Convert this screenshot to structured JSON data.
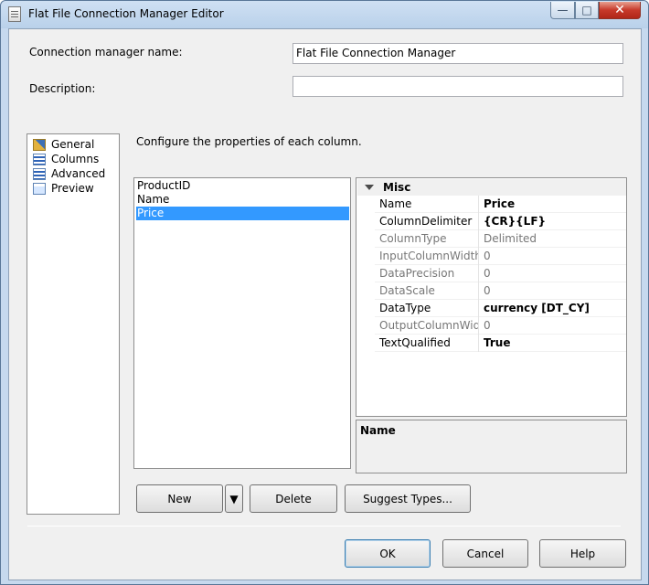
{
  "window": {
    "title": "Flat File Connection Manager Editor"
  },
  "controls": {
    "minimize": "—",
    "maximize": "□",
    "close": "✕"
  },
  "fields": {
    "connection_label": "Connection manager name:",
    "connection_value": "Flat File Connection Manager",
    "description_label": "Description:",
    "description_value": ""
  },
  "sidebar": {
    "items": [
      {
        "label": "General",
        "icon": "general-icon"
      },
      {
        "label": "Columns",
        "icon": "columns-icon"
      },
      {
        "label": "Advanced",
        "icon": "advanced-icon"
      },
      {
        "label": "Preview",
        "icon": "preview-icon"
      }
    ]
  },
  "main": {
    "instruction": "Configure the properties of each column.",
    "columns": [
      "ProductID",
      "Name",
      "Price"
    ],
    "selected_column": "Price"
  },
  "properties": {
    "category": "Misc",
    "rows": [
      {
        "name": "Name",
        "value": "Price",
        "enabled": true,
        "bold": true
      },
      {
        "name": "ColumnDelimiter",
        "value": "{CR}{LF}",
        "enabled": true,
        "bold": true
      },
      {
        "name": "ColumnType",
        "value": "Delimited",
        "enabled": false,
        "bold": false
      },
      {
        "name": "InputColumnWidth",
        "value": "0",
        "enabled": false,
        "bold": false
      },
      {
        "name": "DataPrecision",
        "value": "0",
        "enabled": false,
        "bold": false
      },
      {
        "name": "DataScale",
        "value": "0",
        "enabled": false,
        "bold": false
      },
      {
        "name": "DataType",
        "value": "currency [DT_CY]",
        "enabled": true,
        "bold": true
      },
      {
        "name": "OutputColumnWidtl",
        "value": "0",
        "enabled": false,
        "bold": false
      },
      {
        "name": "TextQualified",
        "value": "True",
        "enabled": true,
        "bold": true
      }
    ],
    "description_title": "Name"
  },
  "buttons": {
    "new": "New",
    "dropdown": "▼",
    "delete": "Delete",
    "suggest": "Suggest Types...",
    "ok": "OK",
    "cancel": "Cancel",
    "help": "Help"
  },
  "colors": {
    "selection": "#3399ff",
    "window_frame": "#c6d9ee",
    "dialog": "#f0f0f0"
  }
}
